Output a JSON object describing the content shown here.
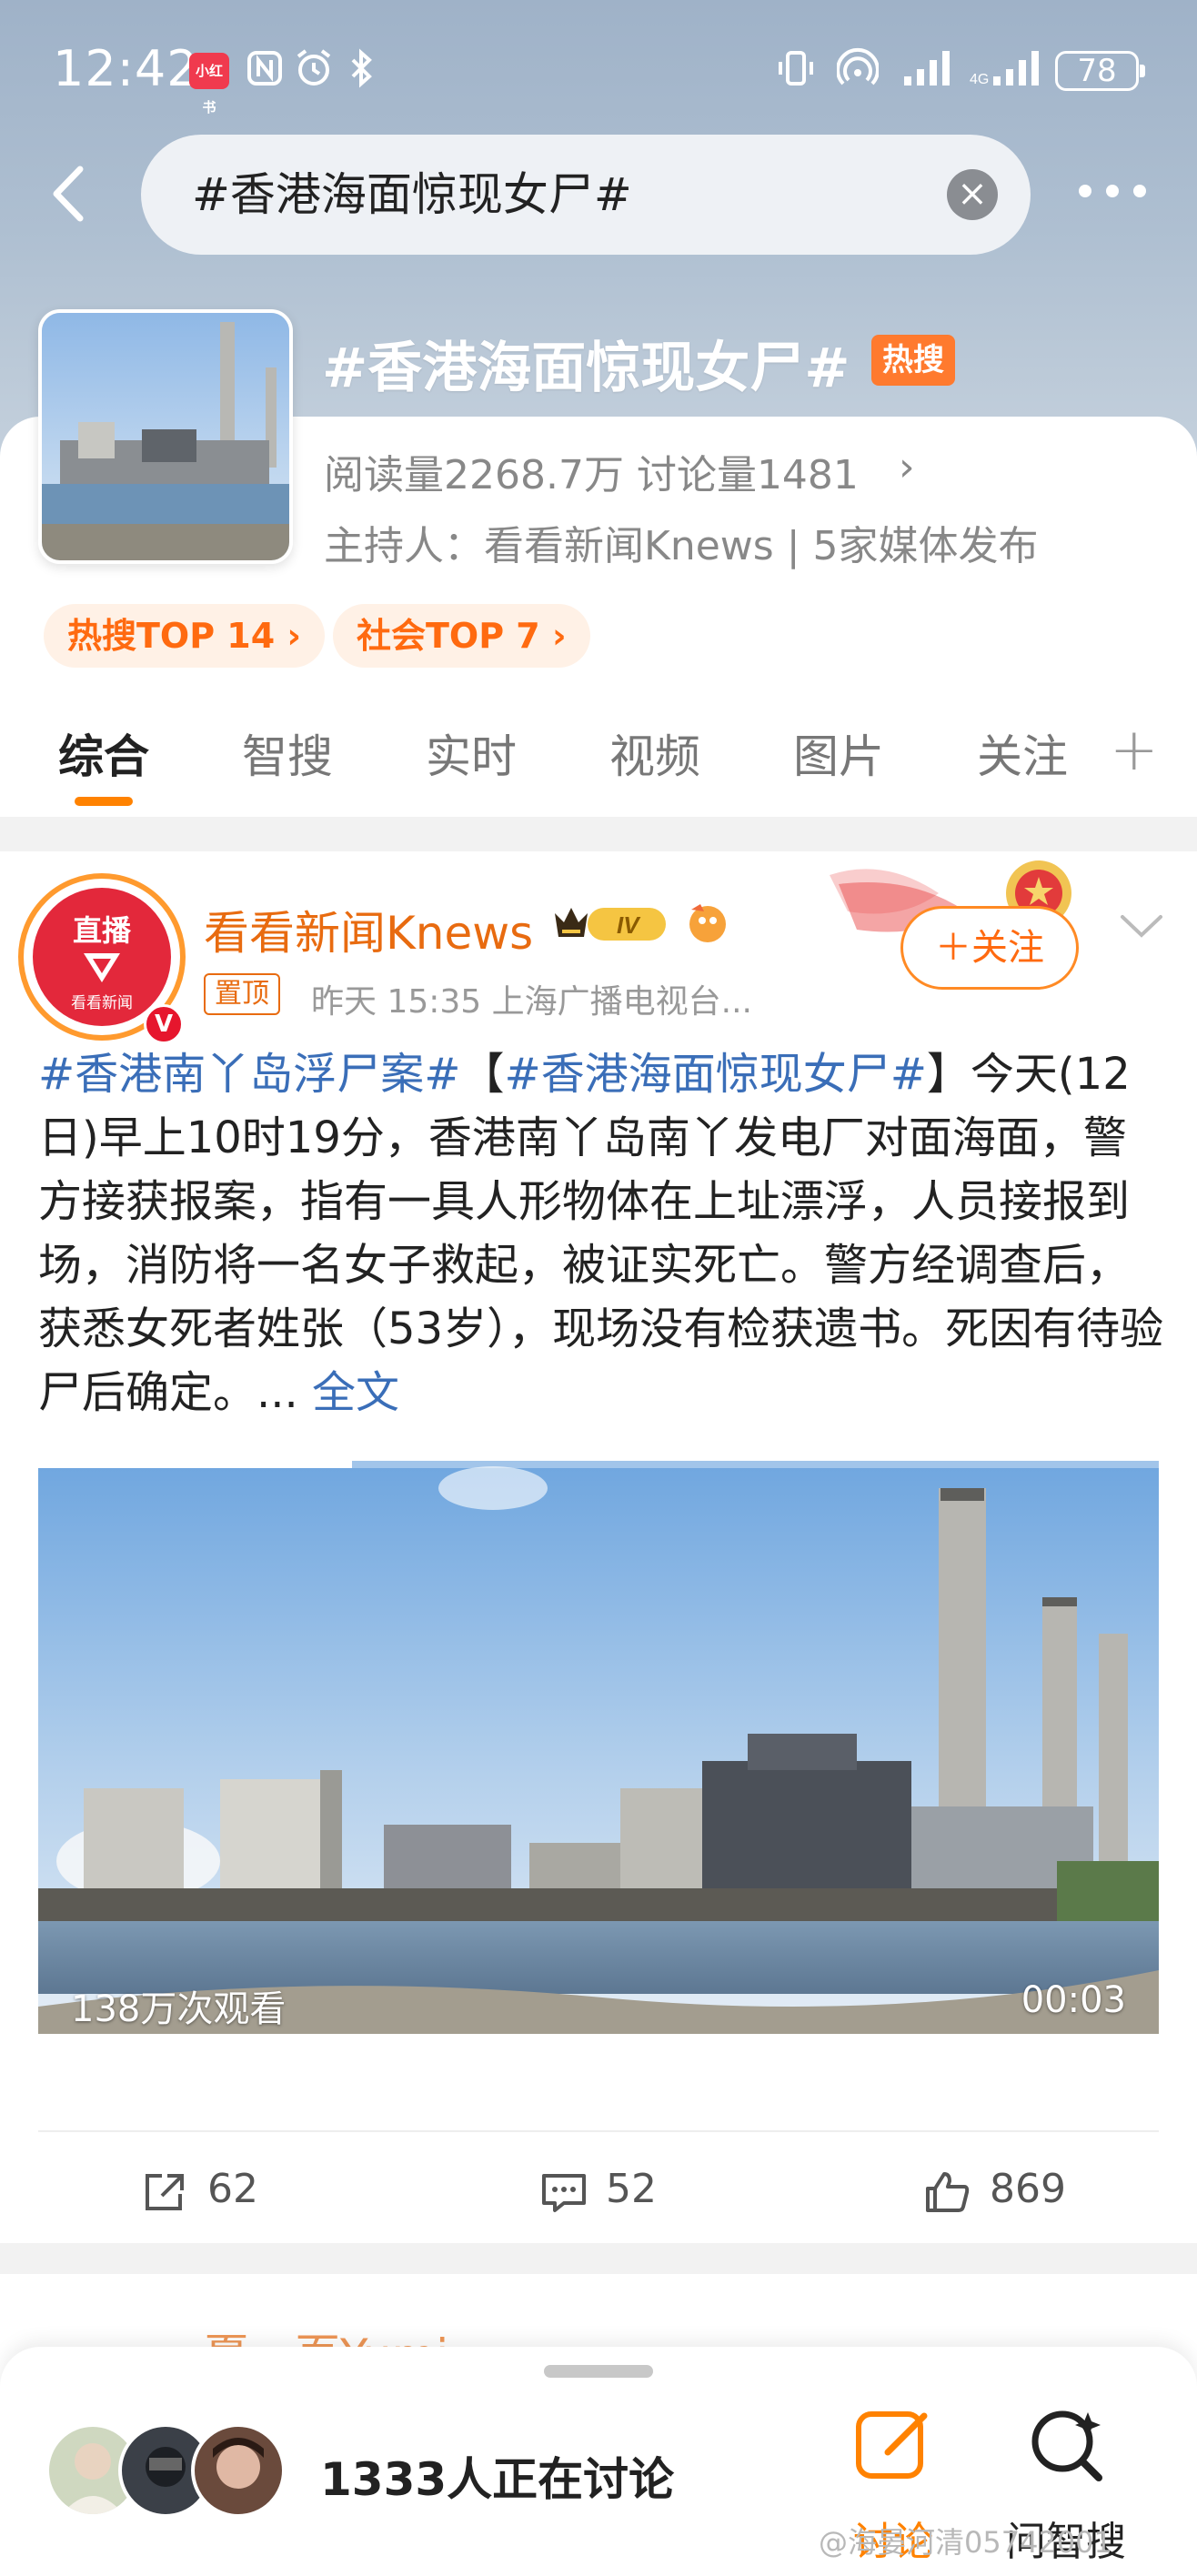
{
  "status_bar": {
    "time": "12:42",
    "app_badge": "小红书",
    "battery": "78"
  },
  "search": {
    "query": "#香港海面惊现女尸#",
    "clear_label": "×"
  },
  "topic": {
    "title": "#香港海面惊现女尸#",
    "hot_badge": "热搜",
    "stats": "阅读量2268.7万  讨论量1481",
    "stats_arrow": "›",
    "host": "主持人：看看新闻Knews | 5家媒体发布",
    "rank_hot": "热搜TOP 14 ›",
    "rank_social": "社会TOP 7 ›"
  },
  "tabs": [
    {
      "label": "综合",
      "active": true
    },
    {
      "label": "智搜"
    },
    {
      "label": "实时"
    },
    {
      "label": "视频"
    },
    {
      "label": "图片"
    },
    {
      "label": "关注"
    }
  ],
  "tab_add": "+",
  "post": {
    "avatar_live": "直播",
    "avatar_sub": "看看新闻",
    "v_badge": "V",
    "author": "看看新闻Knews",
    "vip_level": "IV",
    "pin_tag": "置顶",
    "meta": "昨天 15:35   上海广播电视台...",
    "follow_label": "＋关注",
    "text_tag1": "#香港南丫岛浮尸案#",
    "text_bracket_open": "【",
    "text_tag2": "#香港海面惊现女尸#",
    "text_body": "】今天(12日)早上10时19分，香港南丫岛南丫发电厂对面海面，警方接获报案，指有一具人形物体在上址漂浮，人员接报到场，消防将一名女子救起，被证实死亡。警方经调查后，获悉女死者姓张（53岁），现场没有检获遗书。死因有待验尸后确定。... ",
    "text_more": "全文",
    "video_views": "138万次观看",
    "video_duration": "00:03",
    "video_progress": 0.28,
    "reposts": "62",
    "comments": "52",
    "likes": "869"
  },
  "next_post": {
    "author": "夏一页Yumi"
  },
  "bottom_sheet": {
    "discussing": "1333人正在讨论",
    "discuss_label": "讨论",
    "smart_search_label": "问智搜"
  },
  "watermark": "@海晏河清05742001",
  "colors": {
    "accent": "#ff8200",
    "link": "#3a6eb8",
    "author": "#e86b10",
    "hot": "#ff7a2e"
  }
}
